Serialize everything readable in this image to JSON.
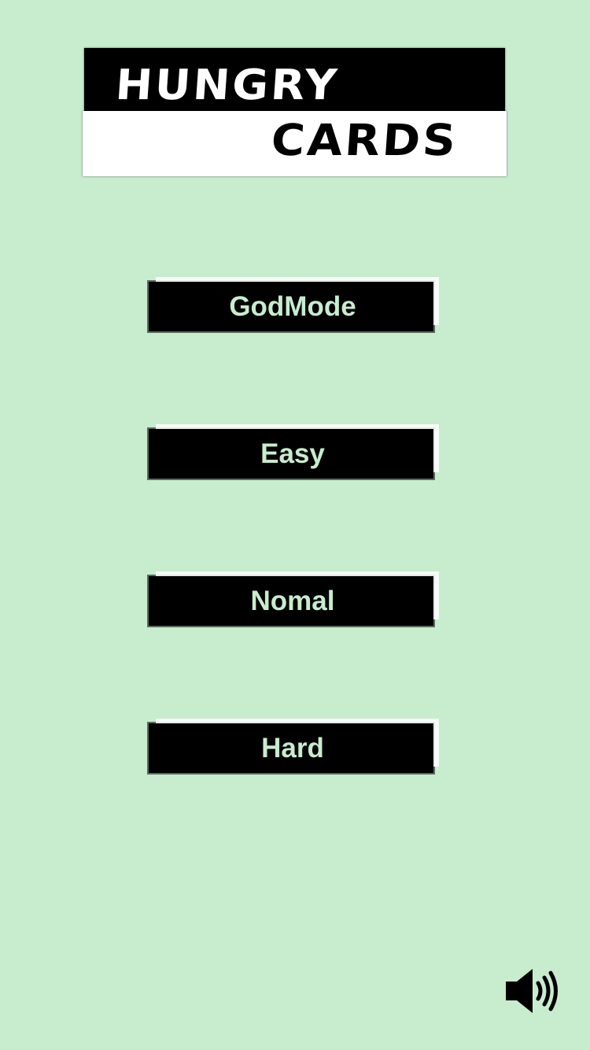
{
  "colors": {
    "background": "#c7ecce",
    "button_bg": "#000000",
    "button_text": "#c7ecce",
    "logo_dark": "#000000",
    "logo_light": "#ffffff"
  },
  "logo": {
    "line1": "HUNGRY",
    "line2": "CARDS"
  },
  "menu": {
    "items": [
      {
        "label": "GodMode"
      },
      {
        "label": "Easy"
      },
      {
        "label": "Nomal"
      },
      {
        "label": "Hard"
      }
    ]
  },
  "sound": {
    "icon": "speaker-volume-icon",
    "state": "on"
  }
}
